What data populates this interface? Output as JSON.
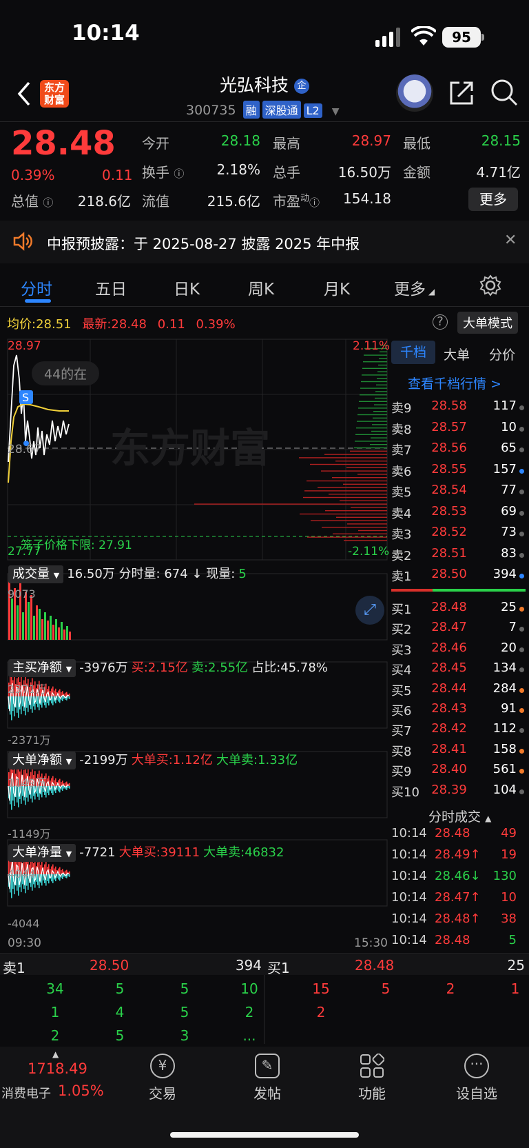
{
  "status_bar": {
    "time": "10:14",
    "battery": "95"
  },
  "header": {
    "back_icon": "chevron-left-icon",
    "logo_text": "东方财富",
    "stock_name": "光弘科技",
    "enterprise_badge": "企",
    "stock_code": "300735",
    "tags": [
      "融",
      "深股通",
      "L2"
    ],
    "share_icon": "share-icon",
    "search_icon": "search-icon"
  },
  "quote": {
    "price": "28.48",
    "change_pct": "0.39%",
    "change": "0.11",
    "open_label": "今开",
    "open": "28.18",
    "high_label": "最高",
    "high": "28.97",
    "low_label": "最低",
    "low": "28.15",
    "turnover_label": "换手",
    "turnover": "2.18%",
    "volume_label": "总手",
    "volume": "16.50万",
    "amount_label": "金额",
    "amount": "4.71亿",
    "mktcap_label": "总值",
    "mktcap": "218.6亿",
    "float_label": "流值",
    "float": "215.6亿",
    "pe_label": "市盈",
    "pe_sup": "动",
    "pe": "154.18",
    "more_label": "更多"
  },
  "notice": {
    "text": "中报预披露：于 2025-08-27 披露 2025 年中报"
  },
  "tabs": [
    "分时",
    "五日",
    "日K",
    "周K",
    "月K",
    "更多"
  ],
  "chart_info": {
    "avg_label": "均价:",
    "avg": "28.51",
    "latest_label": "最新:",
    "latest": "28.48",
    "latest_change": "0.11",
    "latest_pct": "0.39%",
    "big_order_mode": "大单模式",
    "y_top": "28.97",
    "y_bottom": "27.77",
    "y_mid": "28.67",
    "pct_top": "2.11%",
    "pct_bottom": "-2.11%",
    "floor_label": "笼子价格下限:",
    "floor_value": "27.91",
    "watermark": "东方财富",
    "viewers": "44的在",
    "signal": "S",
    "time_start": "09:30",
    "time_end": "15:30"
  },
  "indicators": [
    {
      "btn": "成交量",
      "text": "16.50万 分时量: 674 ↓ 现量:",
      "extra": "5",
      "y_top": "9073",
      "y_bottom": ""
    },
    {
      "btn": "主买净额",
      "text": "-3976万",
      "buy": "买:2.15亿",
      "sell": "卖:2.55亿",
      "ratio": "占比:45.78%",
      "y_top": "2371万",
      "y_bottom": "-2371万"
    },
    {
      "btn": "大单净额",
      "text": "-2199万",
      "buy": "大单买:1.12亿",
      "sell": "大单卖:1.33亿",
      "y_top": "1149万",
      "y_bottom": "-1149万"
    },
    {
      "btn": "大单净量",
      "text": "-7721",
      "buy": "大单买:39111",
      "sell": "大单卖:46832",
      "y_top": "4044",
      "y_bottom": "-4044"
    }
  ],
  "order_book": {
    "tabs": [
      "千档",
      "大单",
      "分价"
    ],
    "view_link": "查看千档行情 >",
    "asks": [
      {
        "label": "卖9",
        "price": "28.58",
        "vol": "117"
      },
      {
        "label": "卖8",
        "price": "28.57",
        "vol": "10"
      },
      {
        "label": "卖7",
        "price": "28.56",
        "vol": "65"
      },
      {
        "label": "卖6",
        "price": "28.55",
        "vol": "157"
      },
      {
        "label": "卖5",
        "price": "28.54",
        "vol": "77"
      },
      {
        "label": "卖4",
        "price": "28.53",
        "vol": "69"
      },
      {
        "label": "卖3",
        "price": "28.52",
        "vol": "73"
      },
      {
        "label": "卖2",
        "price": "28.51",
        "vol": "83"
      },
      {
        "label": "卖1",
        "price": "28.50",
        "vol": "394"
      }
    ],
    "bids": [
      {
        "label": "买1",
        "price": "28.48",
        "vol": "25"
      },
      {
        "label": "买2",
        "price": "28.47",
        "vol": "7"
      },
      {
        "label": "买3",
        "price": "28.46",
        "vol": "20"
      },
      {
        "label": "买4",
        "price": "28.45",
        "vol": "134"
      },
      {
        "label": "买5",
        "price": "28.44",
        "vol": "284"
      },
      {
        "label": "买6",
        "price": "28.43",
        "vol": "91"
      },
      {
        "label": "买7",
        "price": "28.42",
        "vol": "112"
      },
      {
        "label": "买8",
        "price": "28.41",
        "vol": "158"
      },
      {
        "label": "买9",
        "price": "28.40",
        "vol": "561"
      },
      {
        "label": "买10",
        "price": "28.39",
        "vol": "104"
      }
    ],
    "trades_title": "分时成交",
    "trades": [
      {
        "time": "10:14",
        "price": "28.48",
        "dir": "",
        "vol": "49"
      },
      {
        "time": "10:14",
        "price": "28.49↑",
        "dir": "up",
        "vol": "19"
      },
      {
        "time": "10:14",
        "price": "28.46↓",
        "dir": "down",
        "vol": "130"
      },
      {
        "time": "10:14",
        "price": "28.47↑",
        "dir": "up",
        "vol": "10"
      },
      {
        "time": "10:14",
        "price": "28.48↑",
        "dir": "up",
        "vol": "38"
      },
      {
        "time": "10:14",
        "price": "28.48",
        "dir": "",
        "vol": "5"
      }
    ]
  },
  "queue": {
    "ask_label": "卖1",
    "ask_price": "28.50",
    "ask_vol": "394",
    "bid_label": "买1",
    "bid_price": "28.48",
    "bid_vol": "25",
    "ask_rows": [
      [
        "34",
        "5",
        "5",
        "10"
      ],
      [
        "1",
        "4",
        "5",
        "2"
      ],
      [
        "2",
        "5",
        "3",
        "..."
      ]
    ],
    "bid_rows": [
      [
        "15",
        "5",
        "2",
        "1"
      ],
      [
        "2",
        "",
        "",
        ""
      ]
    ]
  },
  "bottom_nav": {
    "index_value": "1718.49",
    "index_name": "消费电子",
    "index_pct": "1.05%",
    "items": [
      "交易",
      "发帖",
      "功能",
      "设自选"
    ]
  }
}
